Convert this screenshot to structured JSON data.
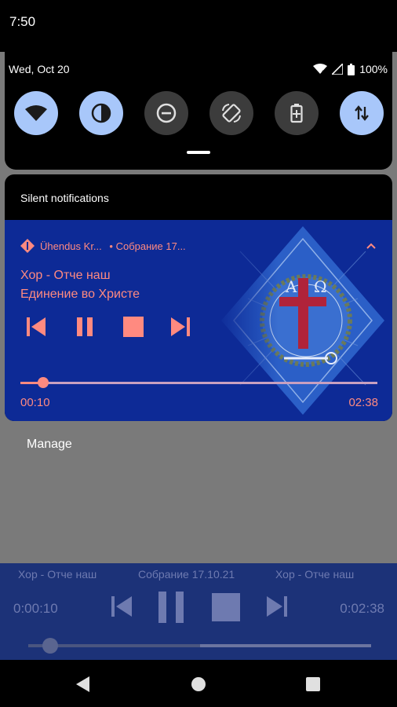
{
  "status_bar": {
    "time": "7:50"
  },
  "quick_settings": {
    "date": "Wed, Oct 20",
    "battery": "100%",
    "tiles": [
      {
        "name": "wifi",
        "state": "on"
      },
      {
        "name": "invert-colors",
        "state": "on"
      },
      {
        "name": "do-not-disturb",
        "state": "off"
      },
      {
        "name": "auto-rotate",
        "state": "off"
      },
      {
        "name": "battery-saver",
        "state": "off"
      },
      {
        "name": "mobile-data",
        "state": "on"
      }
    ]
  },
  "notifications": {
    "section_header": "Silent notifications",
    "media": {
      "app_name": "Ühendus Kr...",
      "sub_text": "• Собрание 17...",
      "title": "Хор - Отче наш",
      "artist": "Единение во Христе",
      "elapsed": "00:10",
      "total": "02:38",
      "progress": 0.063,
      "controls": [
        "previous",
        "pause",
        "stop",
        "next"
      ]
    },
    "manage_label": "Manage"
  },
  "player": {
    "left_title": "Хор - Отче наш",
    "center_title": "Собрание 17.10.21",
    "right_title": "Хор - Отче наш",
    "elapsed": "0:00:10",
    "total": "0:02:38",
    "buffer": 0.5,
    "progress": 0.063
  },
  "colors": {
    "accent_pink": "#ff8a80",
    "tile_on": "#a8c7fa",
    "tile_off": "#3c3c3c",
    "media_bg": "#0d2a96",
    "player_bg": "#1c3278"
  }
}
